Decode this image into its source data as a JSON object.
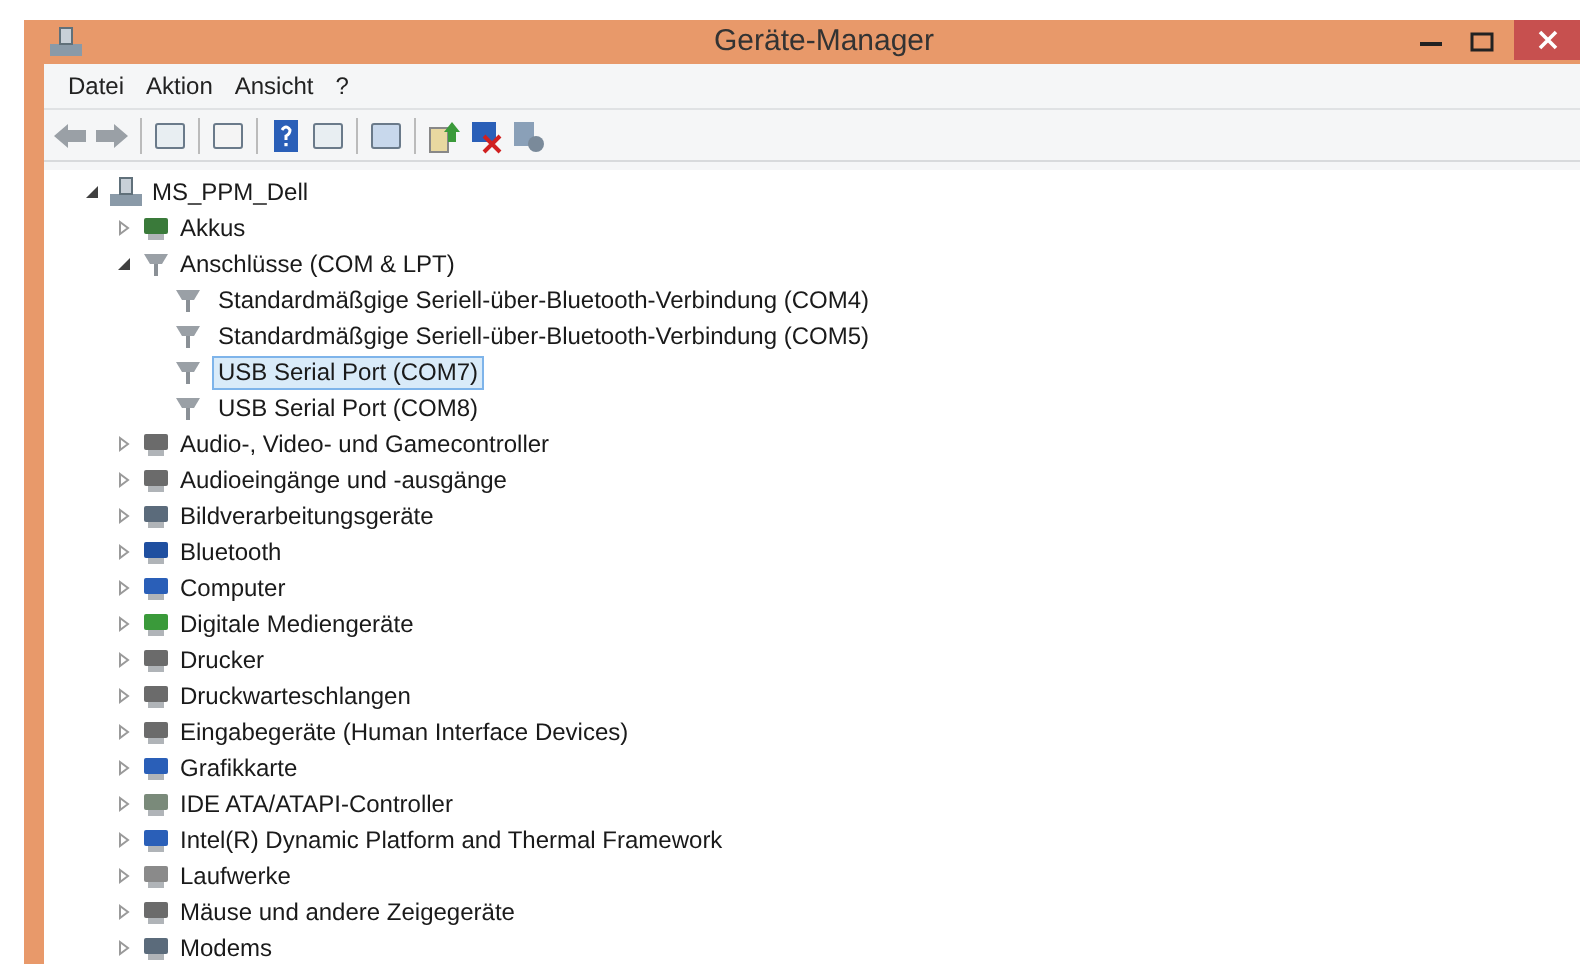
{
  "window": {
    "title": "Geräte-Manager"
  },
  "menu": [
    "Datei",
    "Aktion",
    "Ansicht",
    "?"
  ],
  "tree": {
    "label": "MS_PPM_Dell",
    "expanded": true,
    "children": [
      {
        "label": "Akkus",
        "expanded": false
      },
      {
        "label": "Anschlüsse (COM & LPT)",
        "expanded": true,
        "children": [
          {
            "label": "Standardmäßgige Seriell-über-Bluetooth-Verbindung (COM4)",
            "selected": false
          },
          {
            "label": "Standardmäßgige Seriell-über-Bluetooth-Verbindung (COM5)",
            "selected": false
          },
          {
            "label": "USB Serial Port (COM7)",
            "selected": true
          },
          {
            "label": "USB Serial Port (COM8)",
            "selected": false
          }
        ]
      },
      {
        "label": "Audio-, Video- und Gamecontroller",
        "expanded": false
      },
      {
        "label": "Audioeingänge und -ausgänge",
        "expanded": false
      },
      {
        "label": "Bildverarbeitungsgeräte",
        "expanded": false
      },
      {
        "label": "Bluetooth",
        "expanded": false
      },
      {
        "label": "Computer",
        "expanded": false
      },
      {
        "label": "Digitale Mediengeräte",
        "expanded": false
      },
      {
        "label": "Drucker",
        "expanded": false
      },
      {
        "label": "Druckwarteschlangen",
        "expanded": false
      },
      {
        "label": "Eingabegeräte (Human Interface Devices)",
        "expanded": false
      },
      {
        "label": "Grafikkarte",
        "expanded": false
      },
      {
        "label": "IDE ATA/ATAPI-Controller",
        "expanded": false
      },
      {
        "label": "Intel(R) Dynamic Platform and Thermal Framework",
        "expanded": false
      },
      {
        "label": "Laufwerke",
        "expanded": false
      },
      {
        "label": "Mäuse und andere Zeigegeräte",
        "expanded": false
      },
      {
        "label": "Modems",
        "expanded": false
      }
    ]
  }
}
